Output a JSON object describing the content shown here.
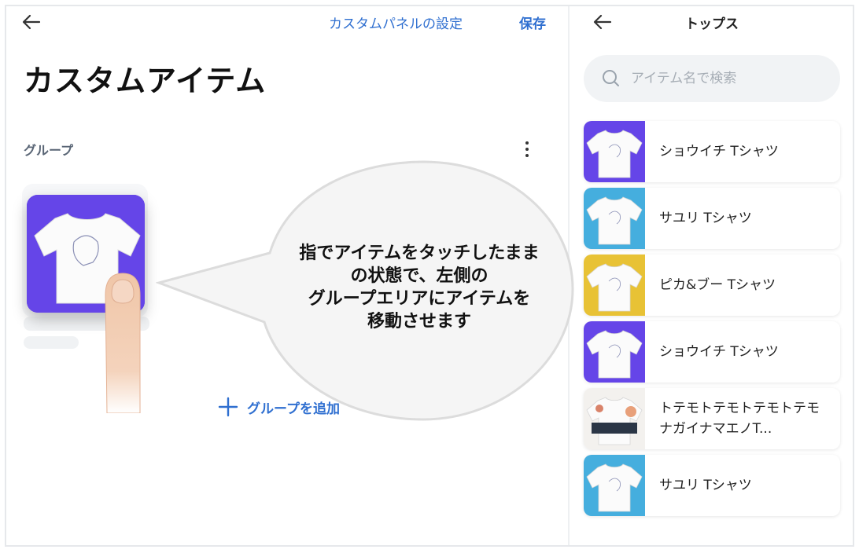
{
  "left": {
    "top_link": "カスタムパネルの設定",
    "save_label": "保存",
    "title": "カスタムアイテム",
    "group_label": "グループ",
    "add_group_label": "グループを追加",
    "callout": [
      "指でアイテムをタッチしたまま",
      "の状態で、左側の",
      "グループエリアにアイテムを",
      "移動させます"
    ],
    "drag_item_color": "#6545e8"
  },
  "right": {
    "title": "トップス",
    "search_placeholder": "アイテム名で検索",
    "items": [
      {
        "name": "ショウイチ Tシャツ",
        "color": "#6545e8"
      },
      {
        "name": "サユリ Tシャツ",
        "color": "#45aede"
      },
      {
        "name": "ピカ&ブー Tシャツ",
        "color": "#e8c235"
      },
      {
        "name": "ショウイチ Tシャツ",
        "color": "#6545e8"
      },
      {
        "name": "トテモトテモトテモトテモナガイナマエノT...",
        "color": "#f3f1ee"
      },
      {
        "name": "サユリ Tシャツ",
        "color": "#45aede"
      }
    ]
  },
  "colors": {
    "accent": "#2f6fd0"
  }
}
